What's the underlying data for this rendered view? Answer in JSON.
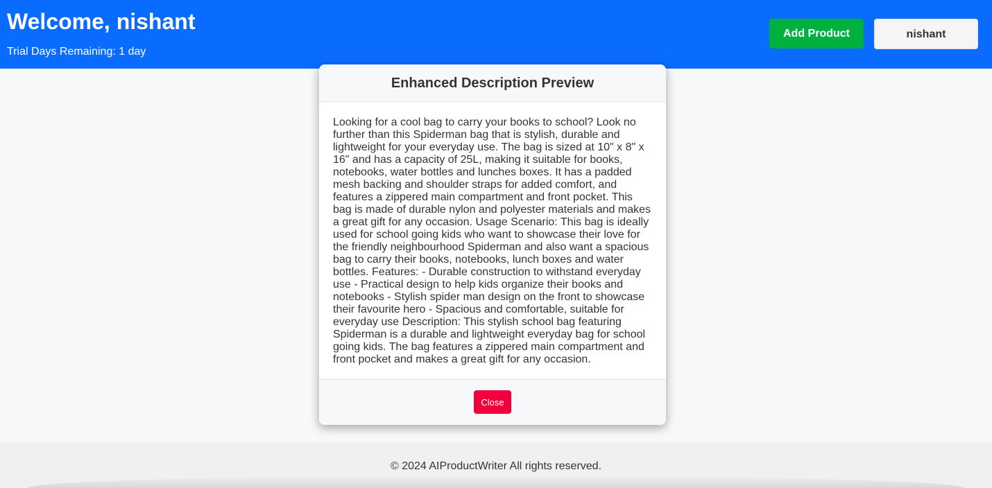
{
  "header": {
    "welcome": "Welcome, nishant",
    "trial": "Trial Days Remaining: 1 day",
    "add_product_label": "Add Product",
    "user_label": "nishant"
  },
  "modal": {
    "title": "Enhanced Description Preview",
    "body": "Looking for a cool bag to carry your books to school? Look no further than this Spiderman bag that is stylish, durable and lightweight for your everyday use. The bag is sized at 10\" x 8\" x 16\" and has a capacity of 25L, making it suitable for books, notebooks, water bottles and lunches boxes. It has a padded mesh backing and shoulder straps for added comfort, and features a zippered main compartment and front pocket. This bag is made of durable nylon and polyester materials and makes a great gift for any occasion. Usage Scenario: This bag is ideally used for school going kids who want to showcase their love for the friendly neighbourhood Spiderman and also want a spacious bag to carry their books, notebooks, lunch boxes and water bottles. Features: - Durable construction to withstand everyday use - Practical design to help kids organize their books and notebooks - Stylish spider man design on the front to showcase their favourite hero - Spacious and comfortable, suitable for everyday use Description: This stylish school bag featuring Spiderman is a durable and lightweight everyday bag for school going kids. The bag features a zippered main compartment and front pocket and makes a great gift for any occasion.",
    "close_label": "Close"
  },
  "footer": {
    "copyright": "© 2024 AIProductWriter All rights reserved."
  },
  "colors": {
    "header_bg": "#0a6cff",
    "add_button": "#00b140",
    "close_button": "#f0003c",
    "page_bg": "#f6f8fa"
  }
}
